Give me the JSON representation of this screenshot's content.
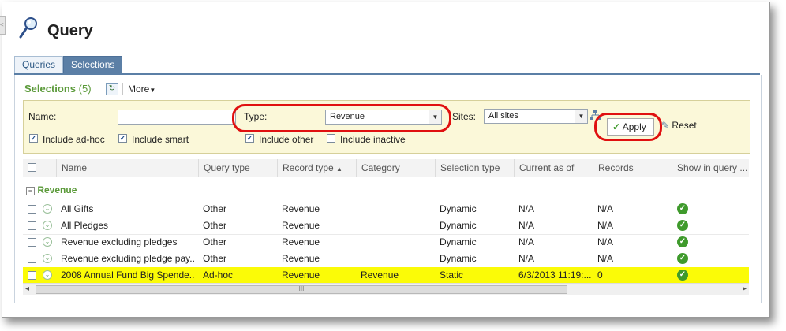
{
  "page": {
    "title": "Query"
  },
  "tabs": [
    {
      "label": "Queries",
      "active": false
    },
    {
      "label": "Selections",
      "active": true
    }
  ],
  "selections": {
    "heading": "Selections",
    "count": "(5)",
    "more_label": "More"
  },
  "filters": {
    "name_label": "Name:",
    "name_value": "",
    "type_label": "Type:",
    "type_value": "Revenue",
    "sites_label": "Sites:",
    "sites_value": "All sites",
    "include_adhoc": "Include ad-hoc",
    "include_smart": "Include smart",
    "include_other": "Include other",
    "include_inactive": "Include inactive",
    "apply_label": "Apply",
    "reset_label": "Reset"
  },
  "grid": {
    "columns": [
      "Name",
      "Query type",
      "Record type",
      "Category",
      "Selection type",
      "Current as of",
      "Records",
      "Show in query ..."
    ],
    "sort_indicator": "▲",
    "group_label": "Revenue",
    "rows": [
      {
        "name": "All Gifts",
        "query_type": "Other",
        "record_type": "Revenue",
        "category": "",
        "selection_type": "Dynamic",
        "current_as_of": "N/A",
        "records": "N/A",
        "highlight": false
      },
      {
        "name": "All Pledges",
        "query_type": "Other",
        "record_type": "Revenue",
        "category": "",
        "selection_type": "Dynamic",
        "current_as_of": "N/A",
        "records": "N/A",
        "highlight": false
      },
      {
        "name": "Revenue excluding pledges",
        "query_type": "Other",
        "record_type": "Revenue",
        "category": "",
        "selection_type": "Dynamic",
        "current_as_of": "N/A",
        "records": "N/A",
        "highlight": false
      },
      {
        "name": "Revenue excluding pledge pay...",
        "query_type": "Other",
        "record_type": "Revenue",
        "category": "",
        "selection_type": "Dynamic",
        "current_as_of": "N/A",
        "records": "N/A",
        "highlight": false
      },
      {
        "name": "2008 Annual Fund Big Spende...",
        "query_type": "Ad-hoc",
        "record_type": "Revenue",
        "category": "Revenue",
        "selection_type": "Static",
        "current_as_of": "6/3/2013 11:19:...",
        "records": "0",
        "highlight": true
      }
    ]
  },
  "scrollbar": {
    "grip": "III",
    "left_arrow": "◂",
    "right_arrow": "▸"
  },
  "colors": {
    "tab_active": "#5b7fa6",
    "group_green": "#5b9a3a",
    "highlight": "#fbfb07",
    "annotation_red": "#e01010"
  }
}
